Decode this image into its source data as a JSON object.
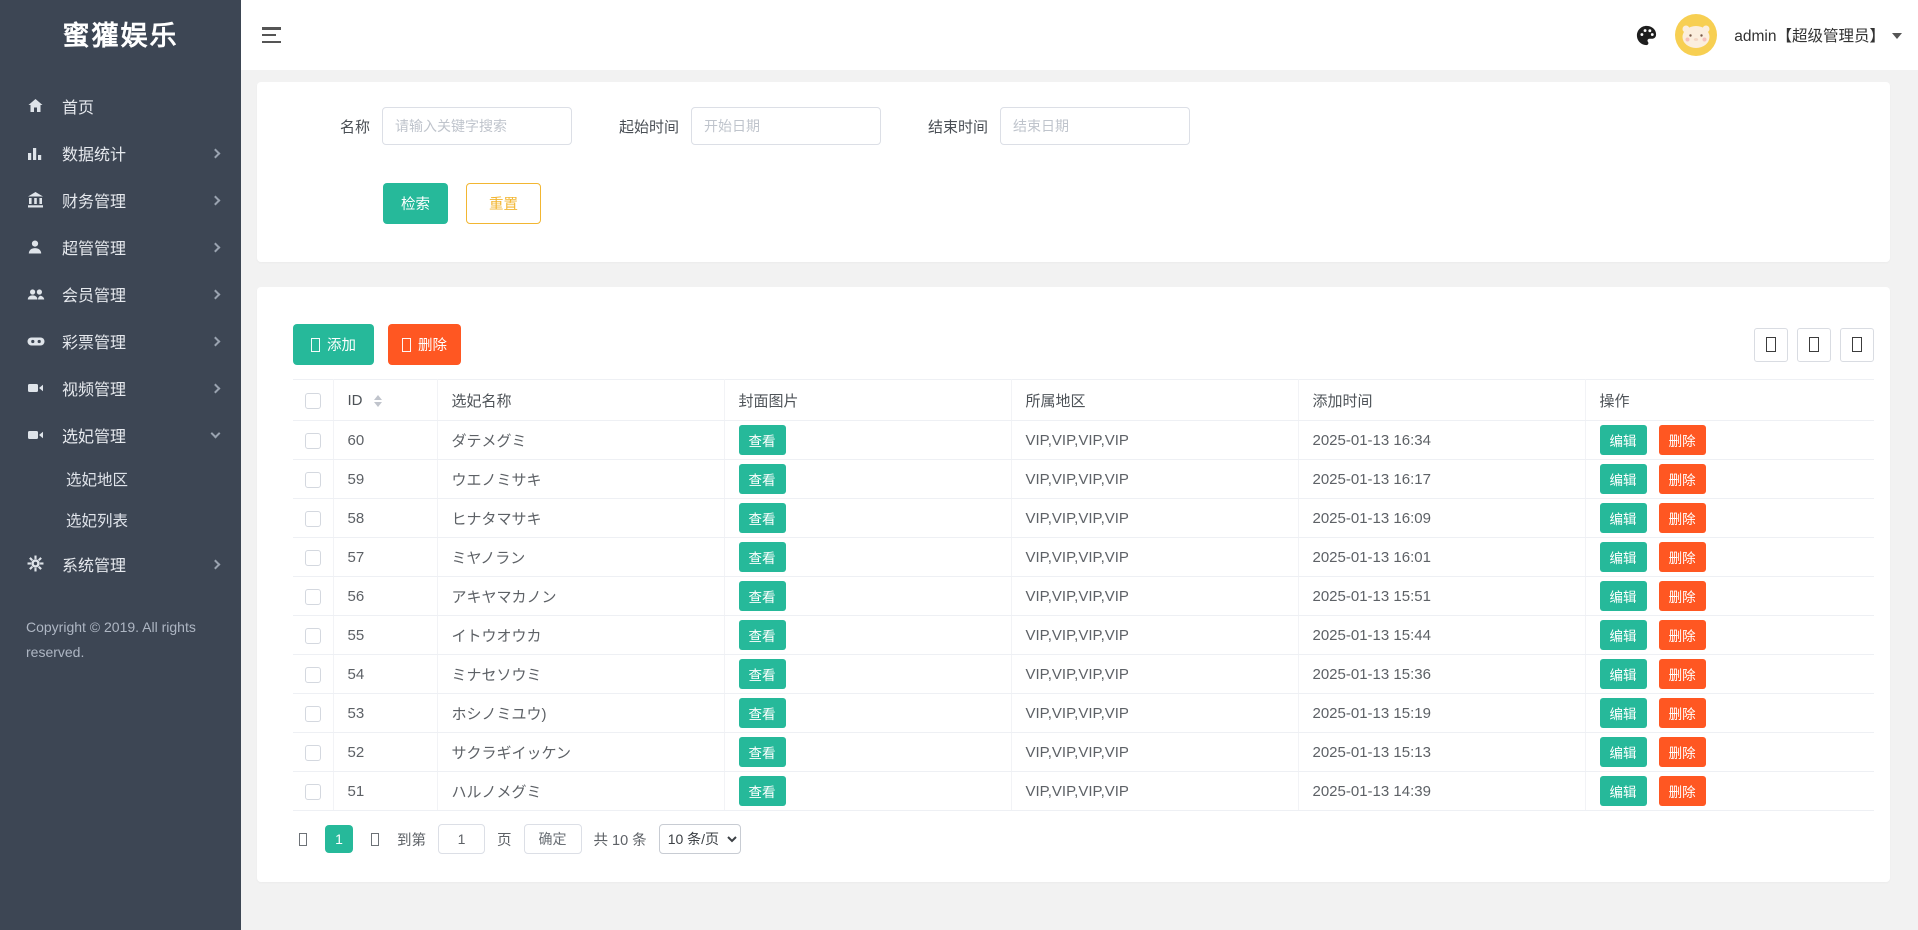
{
  "brand": {
    "logo": "蜜獾娱乐"
  },
  "sidebar": {
    "items": [
      {
        "label": "首页",
        "icon": "home-icon"
      },
      {
        "label": "数据统计",
        "icon": "bar-chart-icon"
      },
      {
        "label": "财务管理",
        "icon": "bank-icon"
      },
      {
        "label": "超管管理",
        "icon": "user-icon"
      },
      {
        "label": "会员管理",
        "icon": "users-icon"
      },
      {
        "label": "彩票管理",
        "icon": "gamepad-icon"
      },
      {
        "label": "视频管理",
        "icon": "video-camera-icon"
      },
      {
        "label": "选妃管理",
        "icon": "video-camera-icon",
        "expanded": true,
        "children": [
          {
            "label": "选妃地区"
          },
          {
            "label": "选妃列表"
          }
        ]
      },
      {
        "label": "系统管理",
        "icon": "gear-icon"
      }
    ],
    "copyright": "Copyright © 2019. All rights reserved."
  },
  "header": {
    "user": "admin【超级管理员】",
    "icons": [
      "menu-icon",
      "palette-icon",
      "avatar",
      "caret-down-icon"
    ]
  },
  "search": {
    "name_label": "名称",
    "name_placeholder": "请输入关键字搜索",
    "start_label": "起始时间",
    "start_placeholder": "开始日期",
    "end_label": "结束时间",
    "end_placeholder": "结束日期",
    "search_button": "检索",
    "reset_button": "重置"
  },
  "toolbar": {
    "add_button": "添加",
    "delete_button": "删除",
    "right_icons": [
      "placeholder-glyph-icon",
      "placeholder-glyph-icon",
      "placeholder-glyph-icon"
    ]
  },
  "table": {
    "columns": [
      "ID",
      "选妃名称",
      "封面图片",
      "所属地区",
      "添加时间",
      "操作"
    ],
    "view_button": "查看",
    "edit_button": "编辑",
    "delete_button": "删除",
    "rows": [
      {
        "id": "60",
        "name": "ダテメグミ",
        "region": "VIP,VIP,VIP,VIP",
        "time": "2025-01-13 16:34"
      },
      {
        "id": "59",
        "name": "ウエノミサキ",
        "region": "VIP,VIP,VIP,VIP",
        "time": "2025-01-13 16:17"
      },
      {
        "id": "58",
        "name": "ヒナタマサキ",
        "region": "VIP,VIP,VIP,VIP",
        "time": "2025-01-13 16:09"
      },
      {
        "id": "57",
        "name": "ミヤノラン",
        "region": "VIP,VIP,VIP,VIP",
        "time": "2025-01-13 16:01"
      },
      {
        "id": "56",
        "name": "アキヤマカノン",
        "region": "VIP,VIP,VIP,VIP",
        "time": "2025-01-13 15:51"
      },
      {
        "id": "55",
        "name": "イトウオウカ",
        "region": "VIP,VIP,VIP,VIP",
        "time": "2025-01-13 15:44"
      },
      {
        "id": "54",
        "name": "ミナセソウミ",
        "region": "VIP,VIP,VIP,VIP",
        "time": "2025-01-13 15:36"
      },
      {
        "id": "53",
        "name": "ホシノミユウ)",
        "region": "VIP,VIP,VIP,VIP",
        "time": "2025-01-13 15:19"
      },
      {
        "id": "52",
        "name": "サクラギイッケン",
        "region": "VIP,VIP,VIP,VIP",
        "time": "2025-01-13 15:13"
      },
      {
        "id": "51",
        "name": "ハルノメグミ",
        "region": "VIP,VIP,VIP,VIP",
        "time": "2025-01-13 14:39"
      }
    ]
  },
  "pagination": {
    "current_page": "1",
    "goto_label": "到第",
    "goto_value": "1",
    "page_label": "页",
    "confirm_button": "确定",
    "total_label": "共 10 条",
    "page_size": "10 条/页"
  },
  "colors": {
    "teal": "#26b99a",
    "orange": "#ff5722",
    "yellow": "#f2b632",
    "sidebar": "#3d4654",
    "avatar_bg": "#f7cf52"
  }
}
